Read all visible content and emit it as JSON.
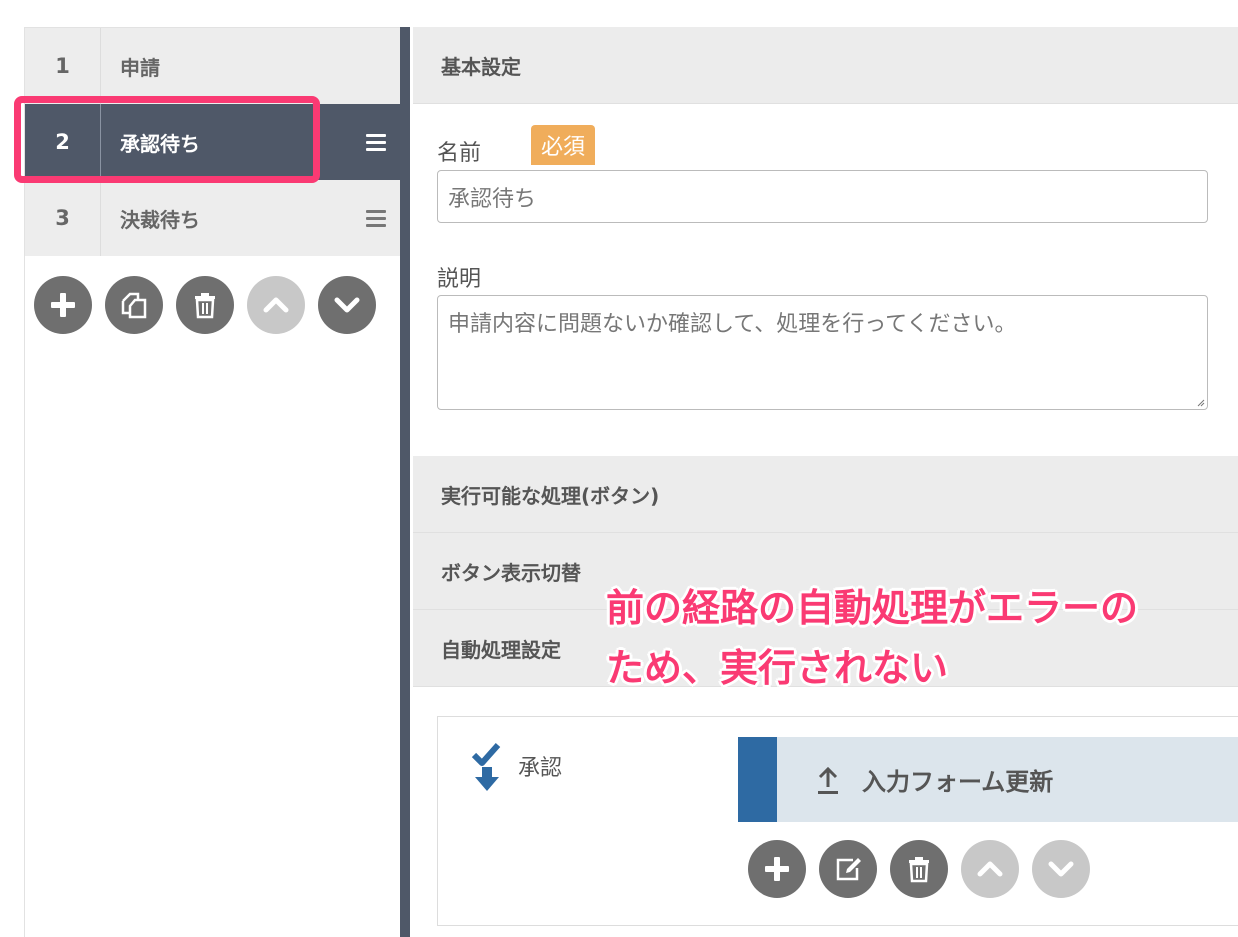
{
  "steps": [
    {
      "num": "1",
      "label": "申請"
    },
    {
      "num": "2",
      "label": "承認待ち"
    },
    {
      "num": "3",
      "label": "決裁待ち"
    }
  ],
  "sections": {
    "basic": "基本設定",
    "actions": "実行可能な処理(ボタン)",
    "button_toggle": "ボタン表示切替",
    "auto": "自動処理設定"
  },
  "form": {
    "name_label": "名前",
    "required_badge": "必須",
    "name_value": "承認待ち",
    "desc_label": "説明",
    "desc_value": "申請内容に問題ないか確認して、処理を行ってください。"
  },
  "auto": {
    "trigger_label": "承認",
    "action_label": "入力フォーム更新"
  },
  "overlay": {
    "line1": "前の経路の自動処理がエラーの",
    "line2": "ため、実行されない"
  },
  "colors": {
    "accent_pink": "#fa3a73",
    "sidebar_active": "#4f5868",
    "badge_orange": "#f0ad5b",
    "action_blue": "#2e6aa3"
  }
}
